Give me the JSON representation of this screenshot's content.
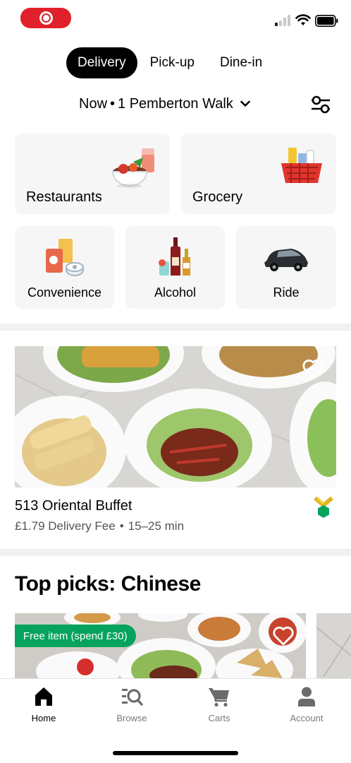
{
  "status_bar": {
    "recording_icon": "screen-record-icon",
    "signal_icon": "signal-icon",
    "wifi_icon": "wifi-icon",
    "battery_icon": "battery-icon"
  },
  "mode_tabs": [
    {
      "label": "Delivery",
      "active": true
    },
    {
      "label": "Pick-up",
      "active": false
    },
    {
      "label": "Dine-in",
      "active": false
    }
  ],
  "location": {
    "time": "Now",
    "separator": "•",
    "address": "1 Pemberton Walk",
    "chevron_icon": "chevron-down-icon",
    "filter_icon": "filter-sliders-icon"
  },
  "categories": [
    {
      "label": "Restaurants",
      "icon": "restaurant-bowl-icon"
    },
    {
      "label": "Grocery",
      "icon": "grocery-basket-icon"
    },
    {
      "label": "Convenience",
      "icon": "convenience-icon"
    },
    {
      "label": "Alcohol",
      "icon": "alcohol-bottles-icon"
    },
    {
      "label": "Ride",
      "icon": "car-icon"
    }
  ],
  "featured_store": {
    "name": "513 Oriental Buffet",
    "delivery_fee": "£1.79 Delivery Fee",
    "separator": "•",
    "eta": "15–25 min",
    "favorite_icon": "heart-outline-icon",
    "badge_icon": "top-eats-badge-icon"
  },
  "top_picks": {
    "title": "Top picks: Chinese",
    "promo": "Free item (spend £30)",
    "favorite_icon": "heart-outline-icon"
  },
  "bottom_nav": [
    {
      "label": "Home",
      "icon": "home-icon",
      "active": true
    },
    {
      "label": "Browse",
      "icon": "browse-search-icon",
      "active": false
    },
    {
      "label": "Carts",
      "icon": "cart-icon",
      "active": false
    },
    {
      "label": "Account",
      "icon": "account-person-icon",
      "active": false
    }
  ],
  "colors": {
    "accent": "#000000",
    "tile_bg": "#f6f6f6",
    "promo_green": "#06a35e",
    "record_red": "#e0202a"
  }
}
